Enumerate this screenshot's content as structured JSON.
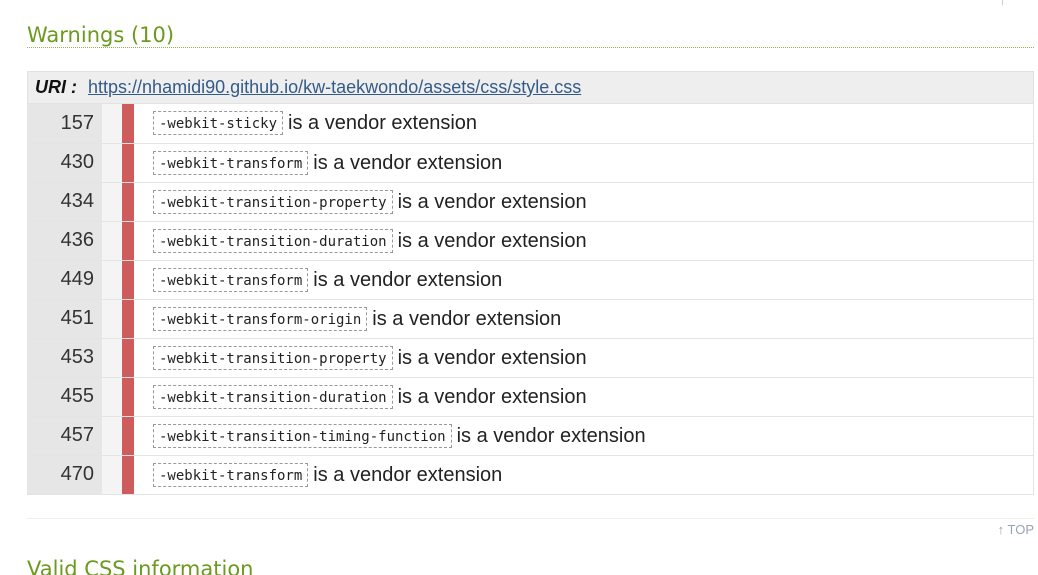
{
  "warnings_section": {
    "title": "Warnings (10)"
  },
  "uri": {
    "label": "URI :",
    "url": "https://nhamidi90.github.io/kw-taekwondo/assets/css/style.css"
  },
  "warnings": [
    {
      "line": "157",
      "code": "-webkit-sticky",
      "message": "is a vendor extension"
    },
    {
      "line": "430",
      "code": "-webkit-transform",
      "message": "is a vendor extension"
    },
    {
      "line": "434",
      "code": "-webkit-transition-property",
      "message": "is a vendor extension"
    },
    {
      "line": "436",
      "code": "-webkit-transition-duration",
      "message": "is a vendor extension"
    },
    {
      "line": "449",
      "code": "-webkit-transform",
      "message": "is a vendor extension"
    },
    {
      "line": "451",
      "code": "-webkit-transform-origin",
      "message": "is a vendor extension"
    },
    {
      "line": "453",
      "code": "-webkit-transition-property",
      "message": "is a vendor extension"
    },
    {
      "line": "455",
      "code": "-webkit-transition-duration",
      "message": "is a vendor extension"
    },
    {
      "line": "457",
      "code": "-webkit-transition-timing-function",
      "message": "is a vendor extension"
    },
    {
      "line": "470",
      "code": "-webkit-transform",
      "message": "is a vendor extension"
    }
  ],
  "top_link": {
    "label": "↑ TOP"
  },
  "next_section": {
    "title": "Valid CSS information"
  },
  "colors": {
    "section_title": "#6b9a1e",
    "warning_marker": "#cf5c5c",
    "link": "#345b87"
  }
}
